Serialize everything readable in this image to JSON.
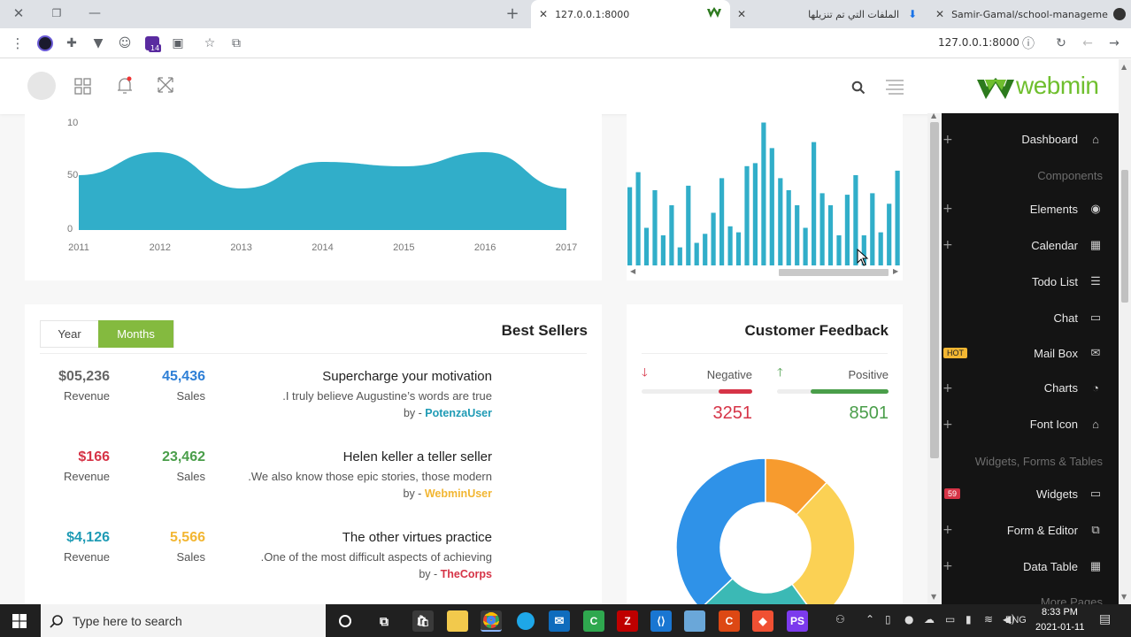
{
  "browser": {
    "tabs": [
      {
        "title": "127.0.0.1:8000",
        "active": true
      },
      {
        "title": "الملفات التي تم تنزيلها",
        "active": false
      },
      {
        "title": "Samir-Gamal/school-manageme",
        "active": false
      }
    ],
    "address": "127.0.0.1:8000",
    "extension_badge": "14"
  },
  "brand": {
    "name": "webmin"
  },
  "area_chart": {
    "y_ticks": [
      "10",
      "50",
      "0"
    ],
    "x_ticks": [
      "2011",
      "2012",
      "2013",
      "2014",
      "2015",
      "2016",
      "2017"
    ]
  },
  "best_sellers": {
    "title": "Best Sellers",
    "tabs": [
      "Year",
      "Months"
    ],
    "active_tab": "Months",
    "rows": [
      {
        "revenue": "$05,236",
        "revenue_label": "Revenue",
        "sales": "45,436",
        "sales_label": "Sales",
        "title": "Supercharge your motivation",
        "desc": ".I truly believe Augustine’s words are true",
        "by": "by - ",
        "author": "PotenzaUser",
        "rev_color": "#666666",
        "sales_color": "#2e7fd6",
        "author_color": "#1f9bb5"
      },
      {
        "revenue": "$166",
        "revenue_label": "Revenue",
        "sales": "23,462",
        "sales_label": "Sales",
        "title": "Helen keller a teller seller",
        "desc": ".We also know those epic stories, those modern",
        "by": "by - ",
        "author": "WebminUser",
        "rev_color": "#d63447",
        "sales_color": "#4a9e4a",
        "author_color": "#f2b632"
      },
      {
        "revenue": "$4,126",
        "revenue_label": "Revenue",
        "sales": "5,566",
        "sales_label": "Sales",
        "title": "The other virtues practice",
        "desc": ".One of the most difficult aspects of achieving",
        "by": "by - ",
        "author": "TheCorps",
        "rev_color": "#1f9bb5",
        "sales_color": "#f2b632",
        "author_color": "#d63447"
      }
    ]
  },
  "feedback": {
    "title": "Customer Feedback",
    "negative_label": "Negative",
    "positive_label": "Positive",
    "negative_value": "3251",
    "positive_value": "8501",
    "negative_color": "#d63447",
    "positive_color": "#4a9e4a"
  },
  "chart_data": [
    {
      "type": "area",
      "x": [
        2011,
        2012,
        2013,
        2014,
        2015,
        2016,
        2017
      ],
      "y_ticks_shown": [
        "0",
        "50",
        "10"
      ],
      "color": "#31aec9"
    },
    {
      "type": "bar",
      "values": [
        52,
        62,
        25,
        50,
        20,
        40,
        12,
        53,
        15,
        21,
        35,
        58,
        26,
        22,
        66,
        68,
        95,
        78,
        58,
        50,
        40,
        25,
        82,
        48,
        40,
        20,
        47,
        60,
        20,
        48,
        22,
        41,
        63
      ],
      "color": "#31aec9"
    },
    {
      "type": "pie",
      "values": [
        37,
        12,
        28,
        23
      ],
      "colors": [
        "#2f92e8",
        "#f79b2e",
        "#fbd154",
        "#3bb9b5"
      ]
    }
  ],
  "sidebar": {
    "items": [
      {
        "label": "Dashboard",
        "icon": "home-icon",
        "glyph": "⌂",
        "plus": true
      },
      {
        "label": "Components",
        "header": true
      },
      {
        "label": "Elements",
        "icon": "palette-icon",
        "glyph": "◉",
        "plus": true
      },
      {
        "label": "Calendar",
        "icon": "calendar-icon",
        "glyph": "▦",
        "plus": true
      },
      {
        "label": "Todo List",
        "icon": "list-icon",
        "glyph": "☰",
        "plus": false
      },
      {
        "label": "Chat",
        "icon": "chat-icon",
        "glyph": "▭",
        "plus": false
      },
      {
        "label": "Mail Box",
        "icon": "mail-icon",
        "glyph": "✉",
        "plus": false,
        "badge": "HOT"
      },
      {
        "label": "Charts",
        "icon": "chart-icon",
        "glyph": "◔",
        "plus": true
      },
      {
        "label": "Font Icon",
        "icon": "font-icon",
        "glyph": "⌂",
        "plus": true
      },
      {
        "label": "Widgets, Forms & Tables",
        "header": true
      },
      {
        "label": "Widgets",
        "icon": "widgets-icon",
        "glyph": "▭",
        "plus": false,
        "badge": "59"
      },
      {
        "label": "Form & Editor",
        "icon": "form-icon",
        "glyph": "⧉",
        "plus": true
      },
      {
        "label": "Data Table",
        "icon": "table-icon",
        "glyph": "▦",
        "plus": true
      },
      {
        "label": "More Pages",
        "header": true
      }
    ]
  },
  "taskbar": {
    "search_placeholder": "Type here to search",
    "time": "8:33 PM",
    "date": "2021-01-11",
    "lang": "ENG"
  }
}
